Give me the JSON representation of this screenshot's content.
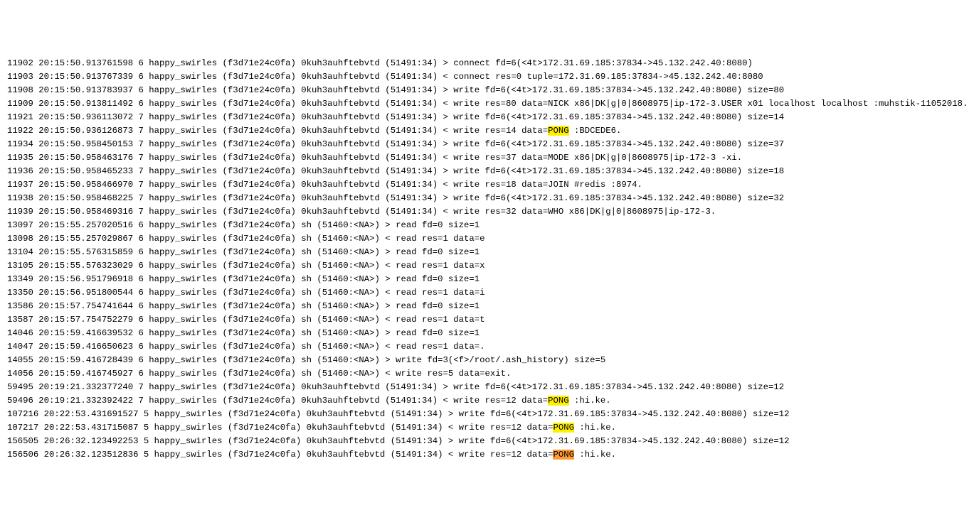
{
  "lines": [
    {
      "id": "11902",
      "ts": "20:15:50.913761598",
      "col": "6",
      "name": "happy_swirles",
      "hash": "(f3d71e24c0fa)",
      "proc": "0kuh3auhftebvtd",
      "pid": "(51491:34)",
      "dir": ">",
      "msg": "connect fd=6(<4t>172.31.69.185:37834->45.132.242.40:8080)",
      "hl": null
    },
    {
      "id": "11903",
      "ts": "20:15:50.913767339",
      "col": "6",
      "name": "happy_swirles",
      "hash": "(f3d71e24c0fa)",
      "proc": "0kuh3auhftebvtd",
      "pid": "(51491:34)",
      "dir": "<",
      "msg": "connect res=0 tuple=172.31.69.185:37834->45.132.242.40:8080",
      "hl": null
    },
    {
      "id": "11908",
      "ts": "20:15:50.913783937",
      "col": "6",
      "name": "happy_swirles",
      "hash": "(f3d71e24c0fa)",
      "proc": "0kuh3auhftebvtd",
      "pid": "(51491:34)",
      "dir": ">",
      "msg": "write fd=6(<4t>172.31.69.185:37834->45.132.242.40:8080) size=80",
      "hl": null
    },
    {
      "id": "11909",
      "ts": "20:15:50.913811492",
      "col": "6",
      "name": "happy_swirles",
      "hash": "(f3d71e24c0fa)",
      "proc": "0kuh3auhftebvtd",
      "pid": "(51491:34)",
      "dir": "<",
      "msg": "write res=80 data=NICK x86|DK|g|0|8608975|ip-172-3.USER x01 localhost localhost :muhstik-11052018.",
      "hl": null
    },
    {
      "id": "11921",
      "ts": "20:15:50.936113072",
      "col": "7",
      "name": "happy_swirles",
      "hash": "(f3d71e24c0fa)",
      "proc": "0kuh3auhftebvtd",
      "pid": "(51491:34)",
      "dir": ">",
      "msg": "write fd=6(<4t>172.31.69.185:37834->45.132.242.40:8080) size=14",
      "hl": null
    },
    {
      "id": "11922",
      "ts": "20:15:50.936126873",
      "col": "7",
      "name": "happy_swirles",
      "hash": "(f3d71e24c0fa)",
      "proc": "0kuh3auhftebvtd",
      "pid": "(51491:34)",
      "dir": "<",
      "msg": "write res=14 data=",
      "hl": {
        "word": "PONG",
        "cls": "hl-yellow"
      },
      "tail": " :BDCEDE6."
    },
    {
      "id": "11934",
      "ts": "20:15:50.958450153",
      "col": "7",
      "name": "happy_swirles",
      "hash": "(f3d71e24c0fa)",
      "proc": "0kuh3auhftebvtd",
      "pid": "(51491:34)",
      "dir": ">",
      "msg": "write fd=6(<4t>172.31.69.185:37834->45.132.242.40:8080) size=37",
      "hl": null
    },
    {
      "id": "11935",
      "ts": "20:15:50.958463176",
      "col": "7",
      "name": "happy_swirles",
      "hash": "(f3d71e24c0fa)",
      "proc": "0kuh3auhftebvtd",
      "pid": "(51491:34)",
      "dir": "<",
      "msg": "write res=37 data=MODE x86|DK|g|0|8608975|ip-172-3 -xi.",
      "hl": null
    },
    {
      "id": "11936",
      "ts": "20:15:50.958465233",
      "col": "7",
      "name": "happy_swirles",
      "hash": "(f3d71e24c0fa)",
      "proc": "0kuh3auhftebvtd",
      "pid": "(51491:34)",
      "dir": ">",
      "msg": "write fd=6(<4t>172.31.69.185:37834->45.132.242.40:8080) size=18",
      "hl": null
    },
    {
      "id": "11937",
      "ts": "20:15:50.958466970",
      "col": "7",
      "name": "happy_swirles",
      "hash": "(f3d71e24c0fa)",
      "proc": "0kuh3auhftebvtd",
      "pid": "(51491:34)",
      "dir": "<",
      "msg": "write res=18 data=JOIN #redis :8974.",
      "hl": null
    },
    {
      "id": "11938",
      "ts": "20:15:50.958468225",
      "col": "7",
      "name": "happy_swirles",
      "hash": "(f3d71e24c0fa)",
      "proc": "0kuh3auhftebvtd",
      "pid": "(51491:34)",
      "dir": ">",
      "msg": "write fd=6(<4t>172.31.69.185:37834->45.132.242.40:8080) size=32",
      "hl": null
    },
    {
      "id": "11939",
      "ts": "20:15:50.958469316",
      "col": "7",
      "name": "happy_swirles",
      "hash": "(f3d71e24c0fa)",
      "proc": "0kuh3auhftebvtd",
      "pid": "(51491:34)",
      "dir": "<",
      "msg": "write res=32 data=WHO x86|DK|g|0|8608975|ip-172-3.",
      "hl": null
    },
    {
      "id": "13097",
      "ts": "20:15:55.257020516",
      "col": "6",
      "name": "happy_swirles",
      "hash": "(f3d71e24c0fa)",
      "proc": "sh",
      "pid": "(51460:<NA>)",
      "dir": ">",
      "msg": "read fd=0 size=1",
      "hl": null
    },
    {
      "id": "13098",
      "ts": "20:15:55.257029867",
      "col": "6",
      "name": "happy_swirles",
      "hash": "(f3d71e24c0fa)",
      "proc": "sh",
      "pid": "(51460:<NA>)",
      "dir": "<",
      "msg": "read res=1 data=e",
      "hl": null
    },
    {
      "id": "13104",
      "ts": "20:15:55.576315859",
      "col": "6",
      "name": "happy_swirles",
      "hash": "(f3d71e24c0fa)",
      "proc": "sh",
      "pid": "(51460:<NA>)",
      "dir": ">",
      "msg": "read fd=0 size=1",
      "hl": null
    },
    {
      "id": "13105",
      "ts": "20:15:55.576323029",
      "col": "6",
      "name": "happy_swirles",
      "hash": "(f3d71e24c0fa)",
      "proc": "sh",
      "pid": "(51460:<NA>)",
      "dir": "<",
      "msg": "read res=1 data=x",
      "hl": null
    },
    {
      "id": "13349",
      "ts": "20:15:56.951796918",
      "col": "6",
      "name": "happy_swirles",
      "hash": "(f3d71e24c0fa)",
      "proc": "sh",
      "pid": "(51460:<NA>)",
      "dir": ">",
      "msg": "read fd=0 size=1",
      "hl": null
    },
    {
      "id": "13350",
      "ts": "20:15:56.951800544",
      "col": "6",
      "name": "happy_swirles",
      "hash": "(f3d71e24c0fa)",
      "proc": "sh",
      "pid": "(51460:<NA>)",
      "dir": "<",
      "msg": "read res=1 data=i",
      "hl": null
    },
    {
      "id": "13586",
      "ts": "20:15:57.754741644",
      "col": "6",
      "name": "happy_swirles",
      "hash": "(f3d71e24c0fa)",
      "proc": "sh",
      "pid": "(51460:<NA>)",
      "dir": ">",
      "msg": "read fd=0 size=1",
      "hl": null
    },
    {
      "id": "13587",
      "ts": "20:15:57.754752279",
      "col": "6",
      "name": "happy_swirles",
      "hash": "(f3d71e24c0fa)",
      "proc": "sh",
      "pid": "(51460:<NA>)",
      "dir": "<",
      "msg": "read res=1 data=t",
      "hl": null
    },
    {
      "id": "14046",
      "ts": "20:15:59.416639532",
      "col": "6",
      "name": "happy_swirles",
      "hash": "(f3d71e24c0fa)",
      "proc": "sh",
      "pid": "(51460:<NA>)",
      "dir": ">",
      "msg": "read fd=0 size=1",
      "hl": null
    },
    {
      "id": "14047",
      "ts": "20:15:59.416650623",
      "col": "6",
      "name": "happy_swirles",
      "hash": "(f3d71e24c0fa)",
      "proc": "sh",
      "pid": "(51460:<NA>)",
      "dir": "<",
      "msg": "read res=1 data=.",
      "hl": null
    },
    {
      "id": "14055",
      "ts": "20:15:59.416728439",
      "col": "6",
      "name": "happy_swirles",
      "hash": "(f3d71e24c0fa)",
      "proc": "sh",
      "pid": "(51460:<NA>)",
      "dir": ">",
      "msg": "write fd=3(<f>/root/.ash_history) size=5",
      "hl": null
    },
    {
      "id": "14056",
      "ts": "20:15:59.416745927",
      "col": "6",
      "name": "happy_swirles",
      "hash": "(f3d71e24c0fa)",
      "proc": "sh",
      "pid": "(51460:<NA>)",
      "dir": "<",
      "msg": "write res=5 data=exit.",
      "hl": null
    },
    {
      "id": "59495",
      "ts": "20:19:21.332377240",
      "col": "7",
      "name": "happy_swirles",
      "hash": "(f3d71e24c0fa)",
      "proc": "0kuh3auhftebvtd",
      "pid": "(51491:34)",
      "dir": ">",
      "msg": "write fd=6(<4t>172.31.69.185:37834->45.132.242.40:8080) size=12",
      "hl": null
    },
    {
      "id": "59496",
      "ts": "20:19:21.332392422",
      "col": "7",
      "name": "happy_swirles",
      "hash": "(f3d71e24c0fa)",
      "proc": "0kuh3auhftebvtd",
      "pid": "(51491:34)",
      "dir": "<",
      "msg": "write res=12 data=",
      "hl": {
        "word": "PONG",
        "cls": "hl-yellow"
      },
      "tail": " :hi.ke."
    },
    {
      "id": "107216",
      "ts": "20:22:53.431691527",
      "col": "5",
      "name": "happy_swirles",
      "hash": "(f3d71e24c0fa)",
      "proc": "0kuh3auhftebvtd",
      "pid": "(51491:34)",
      "dir": ">",
      "msg": "write fd=6(<4t>172.31.69.185:37834->45.132.242.40:8080) size=12",
      "hl": null
    },
    {
      "id": "107217",
      "ts": "20:22:53.431715087",
      "col": "5",
      "name": "happy_swirles",
      "hash": "(f3d71e24c0fa)",
      "proc": "0kuh3auhftebvtd",
      "pid": "(51491:34)",
      "dir": "<",
      "msg": "write res=12 data=",
      "hl": {
        "word": "PONG",
        "cls": "hl-yellow"
      },
      "tail": " :hi.ke."
    },
    {
      "id": "156505",
      "ts": "20:26:32.123492253",
      "col": "5",
      "name": "happy_swirles",
      "hash": "(f3d71e24c0fa)",
      "proc": "0kuh3auhftebvtd",
      "pid": "(51491:34)",
      "dir": ">",
      "msg": "write fd=6(<4t>172.31.69.185:37834->45.132.242.40:8080) size=12",
      "hl": null
    },
    {
      "id": "156506",
      "ts": "20:26:32.123512836",
      "col": "5",
      "name": "happy_swirles",
      "hash": "(f3d71e24c0fa)",
      "proc": "0kuh3auhftebvtd",
      "pid": "(51491:34)",
      "dir": "<",
      "msg": "write res=12 data=",
      "hl": {
        "word": "PONG",
        "cls": "hl-orange"
      },
      "tail": " :hi.ke."
    }
  ]
}
